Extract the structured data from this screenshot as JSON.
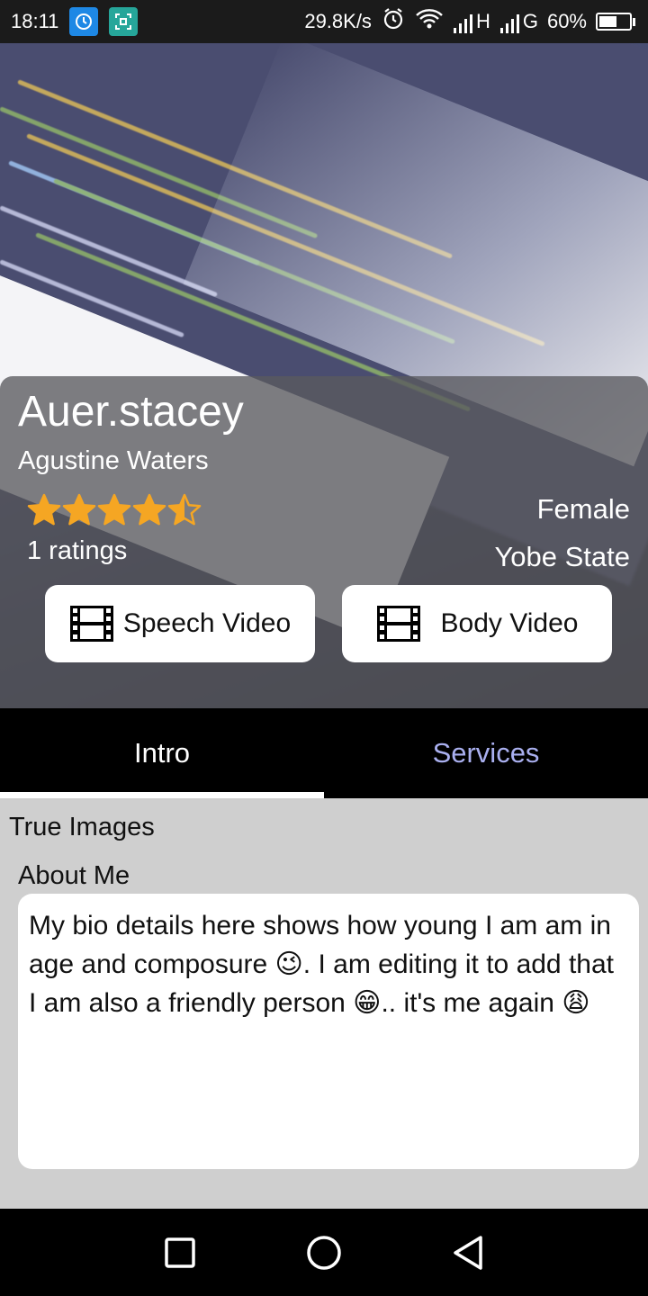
{
  "status_bar": {
    "time": "18:11",
    "speed": "29.8K/s",
    "network_1": "H",
    "network_2": "G",
    "battery": "60%",
    "battery_level": 0.6
  },
  "profile": {
    "username": "Auer.stacey",
    "full_name": "Agustine Waters",
    "rating": 4.5,
    "ratings_text": "1 ratings",
    "gender": "Female",
    "state": "Yobe State",
    "star_color": "#f5a623"
  },
  "buttons": {
    "speech_video": "Speech Video",
    "body_video": "Body Video"
  },
  "tabs": [
    {
      "label": "Intro",
      "active": true
    },
    {
      "label": "Services",
      "active": false
    }
  ],
  "content": {
    "section_title": "True Images",
    "about_label": "About Me",
    "bio": "My bio details here shows how young I am am in age and composure 😉. I am editing it to add that I am also a friendly person 😁.. it's me again 😩"
  },
  "icons": {
    "status_left_1": "app-notification-icon",
    "status_left_2": "screenshot-icon",
    "alarm": "alarm-icon",
    "wifi": "wifi-icon",
    "signal": "signal-icon",
    "battery": "battery-icon",
    "film": "film-icon",
    "nav_recents": "square-icon",
    "nav_home": "circle-icon",
    "nav_back": "triangle-back-icon"
  }
}
